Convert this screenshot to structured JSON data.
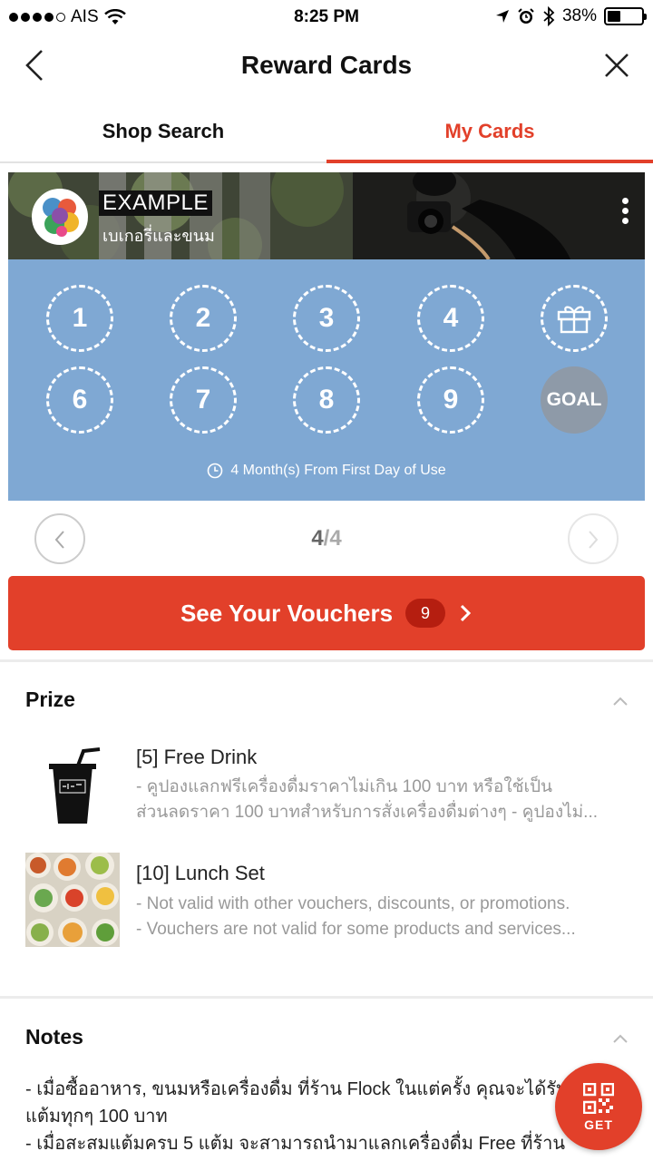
{
  "status_bar": {
    "carrier": "AIS",
    "time": "8:25 PM",
    "battery": "38%",
    "battery_level": 0.38
  },
  "header": {
    "title": "Reward Cards",
    "back_icon": "chevron-left-icon",
    "close_icon": "close-icon"
  },
  "tabs": [
    {
      "label": "Shop Search",
      "active": false
    },
    {
      "label": "My Cards",
      "active": true
    }
  ],
  "card": {
    "shop_name": "EXAMPLE",
    "shop_subtitle": "เบเกอรี่และขนม",
    "stamps": [
      "1",
      "2",
      "3",
      "4",
      "6",
      "7",
      "8",
      "9"
    ],
    "gift_icon": "gift-icon",
    "goal_label": "GOAL",
    "validity": "4 Month(s) From First Day of Use",
    "colors": {
      "card_bg": "#7fa8d3",
      "goal_bg": "#8e9aa8"
    }
  },
  "pager": {
    "current": "4",
    "total": "/4"
  },
  "vouchers": {
    "label": "See Your Vouchers",
    "count": "9"
  },
  "prize": {
    "title": "Prize",
    "items": [
      {
        "name": "[5] Free Drink",
        "line1": "- คูปองแลกฟรีเครื่องดื่มราคาไม่เกิน 100 บาท หรือใช้เป็น",
        "line2": "ส่วนลดราคา 100 บาทสำหรับการสั่งเครื่องดื่มต่างๆ - คูปองไม่..."
      },
      {
        "name": "[10] Lunch Set",
        "line1": "- Not valid with other vouchers, discounts, or promotions.",
        "line2": "- Vouchers are not valid for some products and services..."
      }
    ]
  },
  "notes": {
    "title": "Notes",
    "lines": [
      "- เมื่อซื้ออาหาร, ขนมหรือเครื่องดื่ม ที่ร้าน Flock ในแต่ครั้ง คุณจะได้รับ",
      "แต้มทุกๆ 100 บาท",
      "- เมื่อสะสมแต้มครบ 5 แต้ม จะสามารถนำมาแลกเครื่องดื่ม Free ที่ร้าน"
    ]
  },
  "get_button": {
    "label": "GET",
    "icon": "qr-code-icon"
  },
  "colors": {
    "accent": "#e2402a",
    "badge": "#b51e10"
  }
}
